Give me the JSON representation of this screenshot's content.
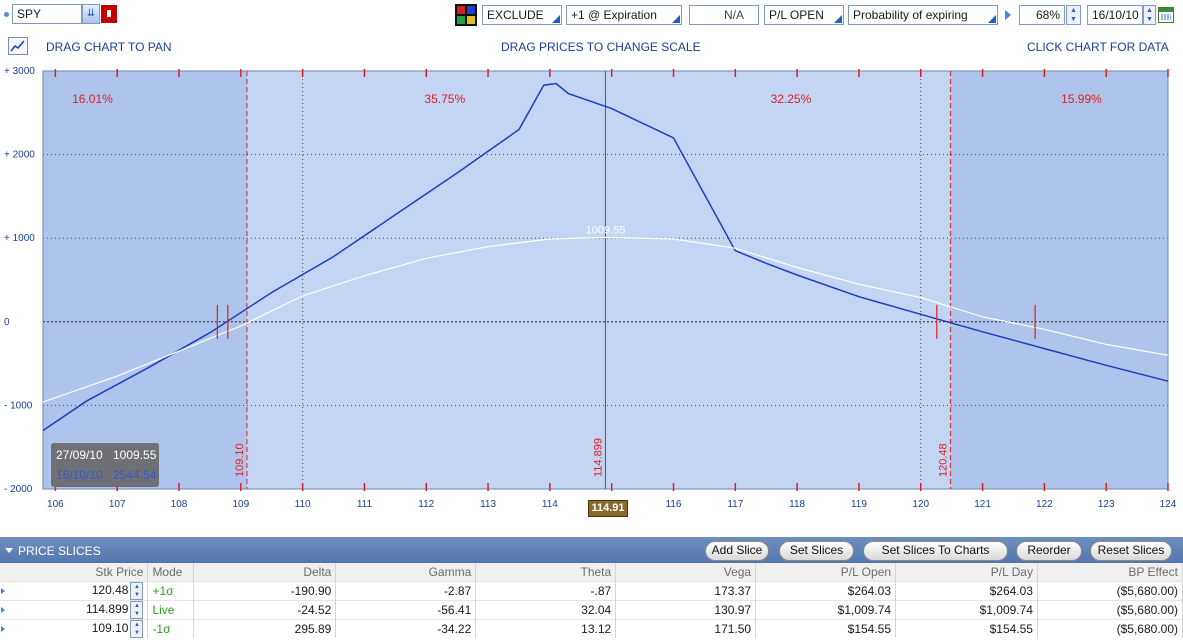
{
  "toolbar": {
    "symbol": "SPY",
    "exclude": "EXCLUDE",
    "expiration": "+1 @ Expiration",
    "na": "N/A",
    "pl_mode": "P/L OPEN",
    "prob_mode": "Probability of expiring",
    "percent": "68%",
    "date": "16/10/10"
  },
  "hints": {
    "pan": "DRAG CHART TO PAN",
    "scale": "DRAG PRICES TO CHANGE SCALE",
    "data": "CLICK CHART FOR DATA"
  },
  "colors": {
    "plot_bg": "#c3d5f3",
    "outer_bg": "#aec4ec",
    "expiration_line": "#1b3fbe",
    "date_line": "#ffffff",
    "accent_red": "#e02020",
    "live_green": "#2e9e1e"
  },
  "chart_data": {
    "type": "line",
    "x_range": [
      105.8,
      124
    ],
    "y_range": [
      -2000,
      3000
    ],
    "x_ticks": [
      "106",
      "107",
      "108",
      "109",
      "110",
      "111",
      "112",
      "113",
      "114",
      "115",
      "116",
      "117",
      "118",
      "119",
      "120",
      "121",
      "122",
      "123",
      "124"
    ],
    "y_ticks": [
      "+ 3000",
      "+ 2000",
      "+ 1000",
      "0",
      "- 1000",
      "- 2000"
    ],
    "zone_percents": [
      "16.01%",
      "35.75%",
      "32.25%",
      "15.99%"
    ],
    "marker_labels": [
      "109.10",
      "114.899",
      "120.48"
    ],
    "current_price_label": "114.91",
    "peak_label": "1009.55",
    "series": [
      {
        "name": "16/10/10",
        "x": [
          105.8,
          106.5,
          107.5,
          108.5,
          109.5,
          110.5,
          111.5,
          112.5,
          113.5,
          113.9,
          114.1,
          114.3,
          115,
          116,
          117,
          117.5,
          118,
          119,
          120,
          121,
          122,
          123,
          124
        ],
        "y": [
          -1300,
          -950,
          -550,
          -130,
          350,
          780,
          1280,
          1780,
          2300,
          2830,
          2850,
          2730,
          2550,
          2200,
          850,
          700,
          560,
          300,
          90,
          -120,
          -320,
          -520,
          -710
        ]
      },
      {
        "name": "27/09/10",
        "x": [
          105.8,
          107,
          108,
          109,
          110,
          111,
          112,
          113,
          114,
          114.9,
          116,
          117,
          118,
          119,
          120,
          121,
          122,
          123,
          124
        ],
        "y": [
          -960,
          -650,
          -350,
          -50,
          310,
          550,
          760,
          900,
          990,
          1009.55,
          990,
          880,
          650,
          450,
          290,
          60,
          -90,
          -270,
          -400
        ]
      }
    ]
  },
  "tooltip": {
    "row1_date": "27/09/10",
    "row1_value": "1009.55",
    "row2_date": "16/10/10",
    "row2_value": "2544.54"
  },
  "slices": {
    "title": "PRICE SLICES",
    "buttons": [
      "Add Slice",
      "Set Slices",
      "Set Slices To Charts",
      "Reorder",
      "Reset Slices"
    ],
    "columns": [
      "Stk Price",
      "Mode",
      "Delta",
      "Gamma",
      "Theta",
      "Vega",
      "P/L Open",
      "P/L Day",
      "BP Effect"
    ],
    "rows": [
      [
        "120.48",
        "+1σ",
        "-190.90",
        "-2.87",
        "-.87",
        "173.37",
        "$264.03",
        "$264.03",
        "($5,680.00)"
      ],
      [
        "114.899",
        "Live",
        "-24.52",
        "-56.41",
        "32.04",
        "130.97",
        "$1,009.74",
        "$1,009.74",
        "($5,680.00)"
      ],
      [
        "109.10",
        "-1σ",
        "295.89",
        "-34.22",
        "13.12",
        "171.50",
        "$154.55",
        "$154.55",
        "($5,680.00)"
      ]
    ]
  }
}
